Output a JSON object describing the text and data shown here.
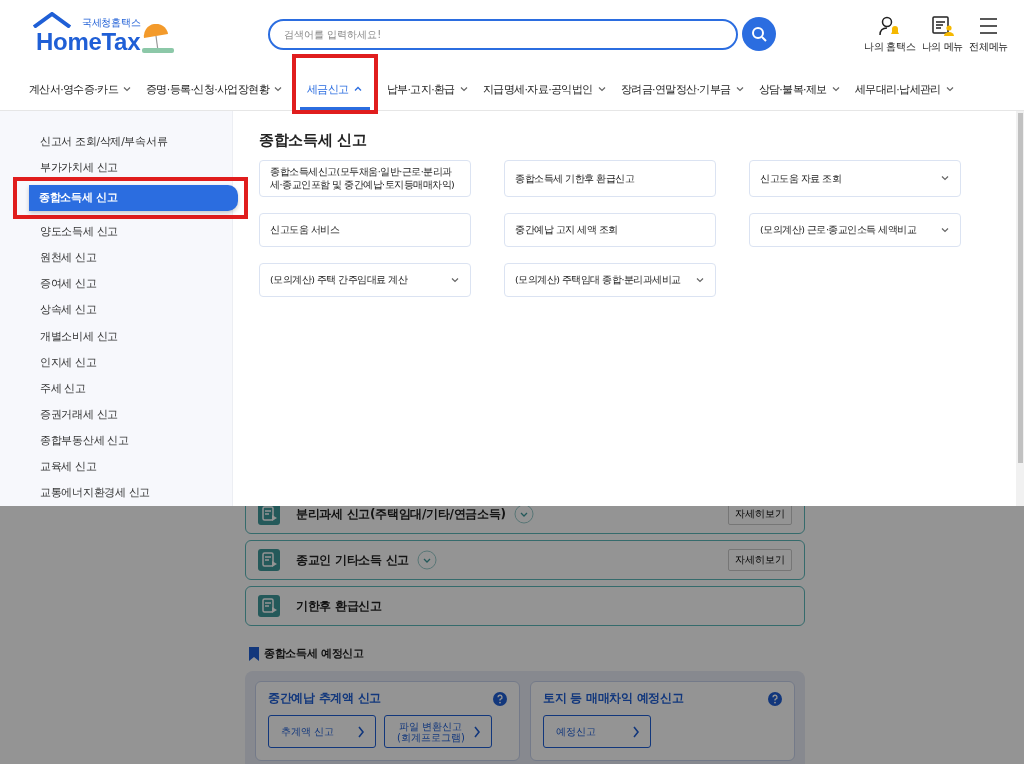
{
  "logo": {
    "caption": "국세청홈택스",
    "name": "HomeTax"
  },
  "search": {
    "placeholder": "검색어를 입력하세요!"
  },
  "header_links": [
    {
      "kind": "my-hometax",
      "label": "나의 홈택스"
    },
    {
      "kind": "my-menu",
      "label": "나의 메뉴"
    },
    {
      "kind": "all-menu",
      "label": "전체메뉴"
    }
  ],
  "nav": [
    {
      "label": "계산서·영수증·카드",
      "selected": false,
      "highlighted": false
    },
    {
      "label": "증명·등록·신청·사업장현황",
      "selected": false,
      "highlighted": false
    },
    {
      "label": "세금신고",
      "selected": true,
      "highlighted": true
    },
    {
      "label": "납부·고지·환급",
      "selected": false,
      "highlighted": false
    },
    {
      "label": "지급명세·자료·공익법인",
      "selected": false,
      "highlighted": false
    },
    {
      "label": "장려금·연말정산·기부금",
      "selected": false,
      "highlighted": false
    },
    {
      "label": "상담·불복·제보",
      "selected": false,
      "highlighted": false
    },
    {
      "label": "세무대리·납세관리",
      "selected": false,
      "highlighted": false
    }
  ],
  "sidebar": {
    "items": [
      {
        "label": "신고서 조회/삭제/부속서류",
        "selected": false,
        "highlighted": false
      },
      {
        "label": "부가가치세 신고",
        "selected": false,
        "highlighted": false
      },
      {
        "label": "종합소득세 신고",
        "selected": true,
        "highlighted": true
      },
      {
        "label": "양도소득세 신고",
        "selected": false,
        "highlighted": false
      },
      {
        "label": "원천세 신고",
        "selected": false,
        "highlighted": false
      },
      {
        "label": "증여세 신고",
        "selected": false,
        "highlighted": false
      },
      {
        "label": "상속세 신고",
        "selected": false,
        "highlighted": false
      },
      {
        "label": "개별소비세 신고",
        "selected": false,
        "highlighted": false
      },
      {
        "label": "인지세 신고",
        "selected": false,
        "highlighted": false
      },
      {
        "label": "주세 신고",
        "selected": false,
        "highlighted": false
      },
      {
        "label": "증권거래세 신고",
        "selected": false,
        "highlighted": false
      },
      {
        "label": "종합부동산세 신고",
        "selected": false,
        "highlighted": false
      },
      {
        "label": "교육세 신고",
        "selected": false,
        "highlighted": false
      },
      {
        "label": "교통에너지환경세 신고",
        "selected": false,
        "highlighted": false
      }
    ]
  },
  "panel": {
    "title": "종합소득세 신고",
    "items": [
      {
        "label": "종합소득세신고(모두채움·일반·근로·분리과세·종교인포함 및 중간예납·토지등매매차익)",
        "expandable": false
      },
      {
        "label": "종합소득세 기한후 환급신고",
        "expandable": false
      },
      {
        "label": "신고도움 자료 조회",
        "expandable": true
      },
      {
        "label": "신고도움 서비스",
        "expandable": false
      },
      {
        "label": "중간예납 고지 세액 조회",
        "expandable": false
      },
      {
        "label": "(모의계산) 근로·종교인소득 세액비교",
        "expandable": true
      },
      {
        "label": "(모의계산) 주택 간주임대료 계산",
        "expandable": true
      },
      {
        "label": "(모의계산) 주택임대 종합·분리과세비교",
        "expandable": true
      }
    ]
  },
  "page": {
    "rows": [
      {
        "title": "분리과세 신고(주택임대/기타/연금소득)",
        "expandable": true,
        "detail_button": "자세히보기"
      },
      {
        "title": "종교인 기타소득 신고",
        "expandable": true,
        "detail_button": "자세히보기"
      },
      {
        "title": "기한후 환급신고",
        "expandable": false
      }
    ],
    "section": {
      "title": "종합소득세 예정신고",
      "cards": [
        {
          "title": "중간예납 추계액 신고",
          "buttons": [
            "추계액 신고",
            "파일 변환신고\n(회계프로그램)"
          ]
        },
        {
          "title": "토지 등 매매차익 예정신고",
          "buttons": [
            "예정신고"
          ]
        }
      ]
    }
  }
}
